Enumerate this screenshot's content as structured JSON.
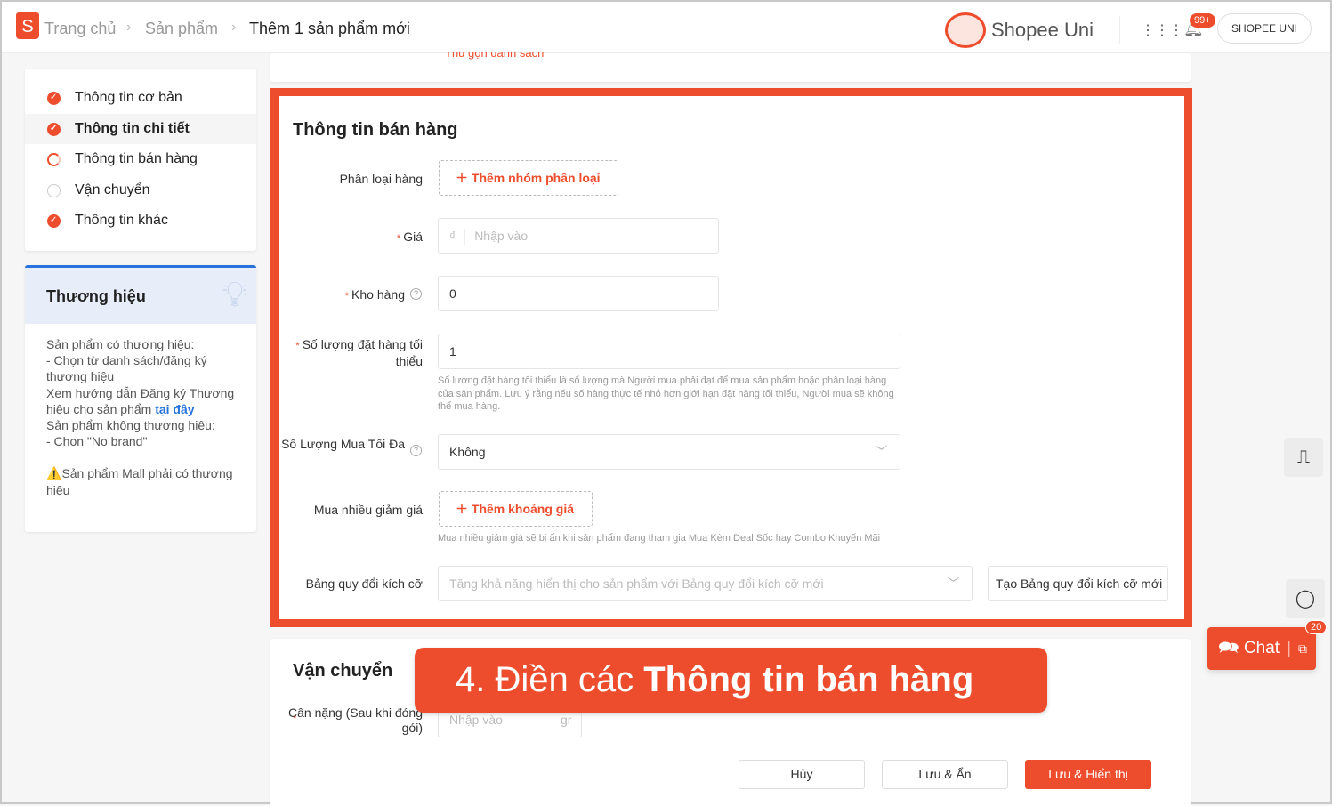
{
  "header": {
    "breadcrumb": [
      "Trang chủ",
      "Sản phẩm",
      "Thêm 1 sản phẩm mới"
    ],
    "brand": "Shopee Uni",
    "notif_badge": "99+",
    "user_button": "SHOPEE UNI",
    "logo_letter": "S"
  },
  "nav": {
    "items": [
      {
        "label": "Thông tin cơ bản",
        "status": "done"
      },
      {
        "label": "Thông tin chi tiết",
        "status": "done",
        "active": true
      },
      {
        "label": "Thông tin bán hàng",
        "status": "in-progress"
      },
      {
        "label": "Vận chuyển",
        "status": "empty"
      },
      {
        "label": "Thông tin khác",
        "status": "done"
      }
    ]
  },
  "tip": {
    "title": "Thương hiệu",
    "lines": [
      "Sản phẩm có thương hiệu:",
      "- Chọn từ danh sách/đăng ký thương hiệu",
      "Xem hướng dẫn Đăng ký Thương hiệu cho sản phẩm"
    ],
    "link": "tại đây",
    "lines2": [
      "Sản phẩm không thương hiệu:",
      "- Chọn \"No brand\""
    ],
    "warning": "Sản phẩm Mall phải có thương hiệu"
  },
  "top_card": {
    "collapse_link": "Thu gọn danh sách"
  },
  "sales": {
    "title": "Thông tin bán hàng",
    "variation": {
      "label": "Phân loại hàng",
      "button": "Thêm nhóm phân loại"
    },
    "price": {
      "label": "Giá",
      "currency": "₫",
      "placeholder": "Nhập vào"
    },
    "stock": {
      "label": "Kho hàng",
      "value": "0"
    },
    "min_order": {
      "label": "Số lượng đặt hàng tối thiểu",
      "value": "1",
      "help": "Số lượng đặt hàng tối thiểu là số lượng mà Người mua phải đạt để mua sản phẩm hoặc phân loại hàng của sản phẩm. Lưu ý rằng nếu số hàng thực tế nhỏ hơn giới hạn đặt hàng tối thiểu, Người mua sẽ không thể mua hàng."
    },
    "max_order": {
      "label": "Số Lượng Mua Tối Đa",
      "value": "Không"
    },
    "wholesale": {
      "label": "Mua nhiều giảm giá",
      "button": "Thêm khoảng giá",
      "help": "Mua nhiều giảm giá sẽ bị ẩn khi sản phẩm đang tham gia Mua Kèm Deal Sốc hay Combo Khuyến Mãi"
    },
    "size_chart": {
      "label": "Bảng quy đổi kích cỡ",
      "placeholder": "Tăng khả năng hiển thị cho sản phẩm với Bảng quy đổi kích cỡ mới",
      "button": "Tạo Bảng quy đổi kích cỡ mới"
    }
  },
  "shipping": {
    "title": "Vận chuyển",
    "weight_label": "Cân nặng (Sau khi đóng gói)",
    "weight_placeholder": "Nhập vào",
    "unit": "gr"
  },
  "overlay": {
    "prefix": "4. Điền các ",
    "bold": "Thông tin bán hàng"
  },
  "footer": {
    "cancel": "Hủy",
    "save_hide": "Lưu & Ẩn",
    "save_show": "Lưu & Hiển thị"
  },
  "chat": {
    "label": "Chat",
    "badge": "20"
  },
  "colors": {
    "accent": "#ee4d2d",
    "link": "#2673dd"
  }
}
